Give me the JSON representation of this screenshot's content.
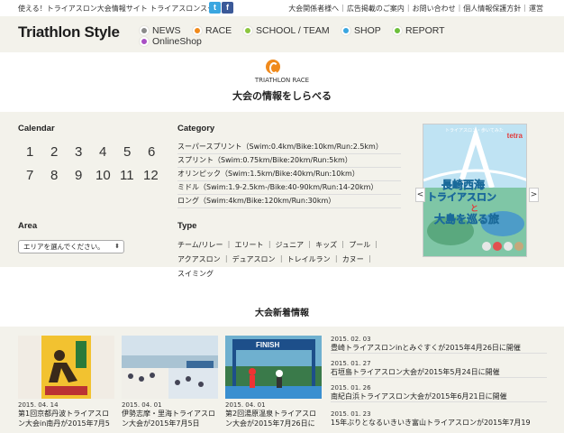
{
  "topbar": {
    "tagline": "使える！トライアスロン大会情報サイト トライアスロンスタイル",
    "links": [
      "大会関係者様へ",
      "広告掲載のご案内",
      "お問い合わせ",
      "個人情報保護方針",
      "運営"
    ]
  },
  "header": {
    "logo": "Triathlon Style",
    "nav": [
      {
        "label": "NEWS",
        "color": "#8a8a8a"
      },
      {
        "label": "RACE",
        "color": "#f08a1c"
      },
      {
        "label": "SCHOOL / TEAM",
        "color": "#8cc63f"
      },
      {
        "label": "SHOP",
        "color": "#3aa6e0"
      },
      {
        "label": "REPORT",
        "color": "#6dbf3b"
      },
      {
        "label": "OnlineShop",
        "color": "#a94fc4"
      }
    ]
  },
  "race": {
    "label": "TRIATHLON RACE",
    "title": "大会の情報をしらべる"
  },
  "calendar": {
    "title": "Calendar",
    "months_row1": [
      "1",
      "2",
      "3",
      "4",
      "5",
      "6"
    ],
    "months_row2": [
      "7",
      "8",
      "9",
      "10",
      "11",
      "12"
    ]
  },
  "category": {
    "title": "Category",
    "items": [
      "スーパースプリント（Swim:0.4km/Bike:10km/Run:2.5km）",
      "スプリント（Swim:0.75km/Bike:20km/Run:5km）",
      "オリンピック（Swim:1.5km/Bike:40km/Run:10km）",
      "ミドル（Swim:1.9-2.5km-/Bike:40-90km/Run:14-20km）",
      "ロング（Swim:4km/Bike:120km/Run:30km）"
    ]
  },
  "area": {
    "title": "Area",
    "placeholder": "エリアを選んでください。"
  },
  "type": {
    "title": "Type",
    "line1": "チーム/リレー ｜ エリート ｜ ジュニア ｜ キッズ ｜ プール ｜",
    "line2": "アクアスロン ｜ デュアスロン ｜ トレイルラン ｜ カヌー ｜",
    "line3": "スイミング"
  },
  "banner": {
    "small": "トライアスロン・歩いてみた",
    "brand": "tetra",
    "line1": "長崎西海",
    "line2": "トライアスロン",
    "line3": "と",
    "line4": "大島を巡る旅",
    "prev": "<",
    "next": ">"
  },
  "news": {
    "title": "大会新着情報",
    "cards": [
      {
        "date": "2015. 04. 14",
        "text": "第1回京都丹波トライアスロン大会in南丹が2015年7月5"
      },
      {
        "date": "2015. 04. 01",
        "text": "伊勢志摩・里海トライアスロン大会が2015年7月5日"
      },
      {
        "date": "2015. 04. 01",
        "text": "第2回湯原温泉トライアスロン大会が2015年7月26日に",
        "finish": "FINISH"
      }
    ],
    "list": [
      {
        "date": "2015. 02. 03",
        "text": "豊崎トライアスロンinとみぐすくが2015年4月26日に開催"
      },
      {
        "date": "2015. 01. 27",
        "text": "石垣島トライアスロン大会が2015年5月24日に開催"
      },
      {
        "date": "2015. 01. 26",
        "text": "南紀白浜トライアスロン大会が2015年6月21日に開催"
      },
      {
        "date": "2015. 01. 23",
        "text": "15年ぶりとなるいきいき富山トライアスロンが2015年7月19"
      }
    ]
  }
}
